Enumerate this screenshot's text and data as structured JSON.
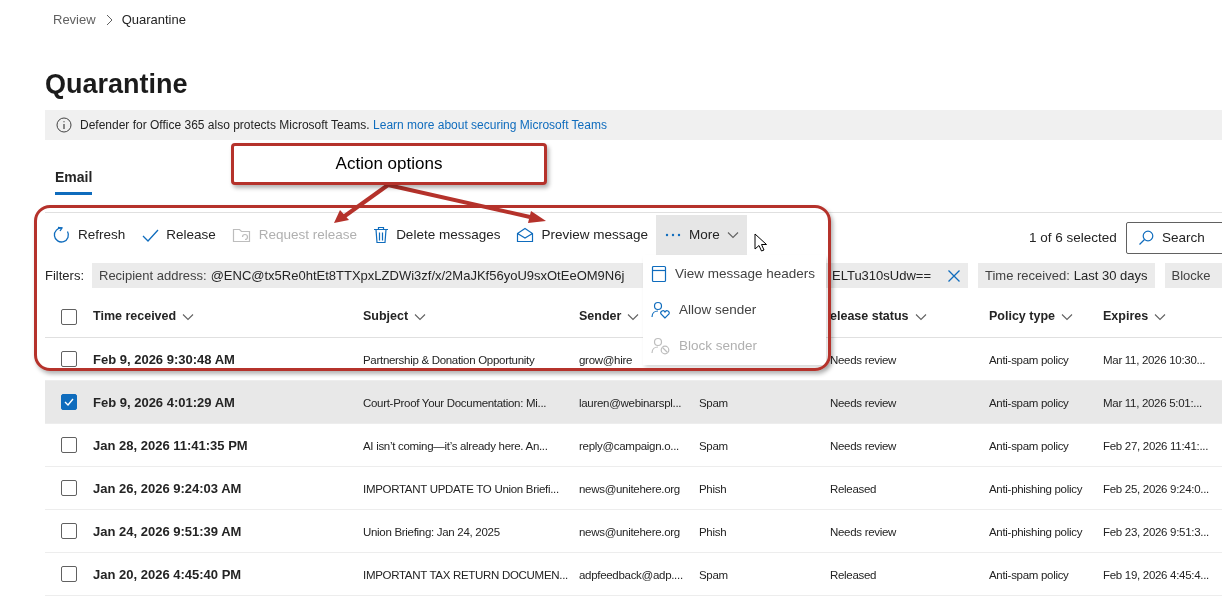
{
  "breadcrumb": [
    {
      "label": "Review",
      "current": false
    },
    {
      "label": "Quarantine",
      "current": true
    }
  ],
  "page_title": "Quarantine",
  "info_bar": {
    "text": "Defender for Office 365 also protects Microsoft Teams.",
    "link": "Learn more about securing Microsoft Teams"
  },
  "tabs": [
    {
      "label": "Email",
      "selected": true
    }
  ],
  "toolbar": [
    {
      "label": "Refresh",
      "kind": "refresh",
      "disabled": false,
      "expanded": false
    },
    {
      "label": "Release",
      "kind": "check",
      "disabled": false,
      "expanded": false
    },
    {
      "label": "Request release",
      "kind": "folder",
      "disabled": true,
      "expanded": false
    },
    {
      "label": "Delete messages",
      "kind": "trash",
      "disabled": false,
      "expanded": false
    },
    {
      "label": "Preview message",
      "kind": "envelope",
      "disabled": false,
      "expanded": false
    },
    {
      "label": "More",
      "kind": "more",
      "disabled": false,
      "expanded": true
    }
  ],
  "selection_count": "1 of 6 selected",
  "search_button": "Search",
  "filters": {
    "label": "Filters:",
    "chips": [
      {
        "kind": "recipient",
        "name": "Recipient address:",
        "value_start": "@ENC@tx5Re0htEt8TTXpxLZDWi3zf/x/2MaJKf56yoU9sxOtEeOM9N6j",
        "value_end": "ELTu310sUdw=="
      },
      {
        "kind": "time",
        "name": "Time received:",
        "value": "Last 30 days"
      },
      {
        "kind": "cut",
        "name": "Blocke"
      }
    ]
  },
  "more_menu": [
    {
      "label": "View message headers",
      "kind": "headers",
      "disabled": false
    },
    {
      "label": "Allow sender",
      "kind": "allow",
      "disabled": false
    },
    {
      "label": "Block sender",
      "kind": "block",
      "disabled": true
    }
  ],
  "table": {
    "select_all_checked": false,
    "columns": [
      "Time received",
      "Subject",
      "Sender",
      "",
      "elease status",
      "Policy type",
      "Expires"
    ],
    "rows": [
      {
        "selected": false,
        "time": "Feb 9, 2026 9:30:48 AM",
        "subject": "Partnership & Donation Opportunity",
        "sender": "grow@hire",
        "type": "",
        "release_status": "Needs review",
        "policy": "Anti-spam policy",
        "expires": "Mar 11, 2026 10:30..."
      },
      {
        "selected": true,
        "time": "Feb 9, 2026 4:01:29 AM",
        "subject": "Court-Proof Your Documentation: Mi...",
        "sender": "lauren@webinarspl...",
        "type": "Spam",
        "release_status": "Needs review",
        "policy": "Anti-spam policy",
        "expires": "Mar 11, 2026 5:01:..."
      },
      {
        "selected": false,
        "time": "Jan 28, 2026 11:41:35 PM",
        "subject": "AI isn’t coming—it’s already here. An...",
        "sender": "reply@campaign.o...",
        "type": "Spam",
        "release_status": "Needs review",
        "policy": "Anti-spam policy",
        "expires": "Feb 27, 2026 11:41:..."
      },
      {
        "selected": false,
        "time": "Jan 26, 2026 9:24:03 AM",
        "subject": "IMPORTANT UPDATE TO Union Briefi...",
        "sender": "news@unitehere.org",
        "type": "Phish",
        "release_status": "Released",
        "policy": "Anti-phishing policy",
        "expires": "Feb 25, 2026 9:24:0..."
      },
      {
        "selected": false,
        "time": "Jan 24, 2026 9:51:39 AM",
        "subject": "Union Briefing: Jan 24, 2025",
        "sender": "news@unitehere.org",
        "type": "Phish",
        "release_status": "Needs review",
        "policy": "Anti-phishing policy",
        "expires": "Feb 23, 2026 9:51:3..."
      },
      {
        "selected": false,
        "time": "Jan 20, 2026 4:45:40 PM",
        "subject": "IMPORTANT TAX RETURN DOCUMEN...",
        "sender": "adpfeedback@adp....",
        "type": "Spam",
        "release_status": "Released",
        "policy": "Anti-spam policy",
        "expires": "Feb 19, 2026 4:45:4..."
      }
    ]
  },
  "annotation": {
    "callout": "Action options"
  }
}
